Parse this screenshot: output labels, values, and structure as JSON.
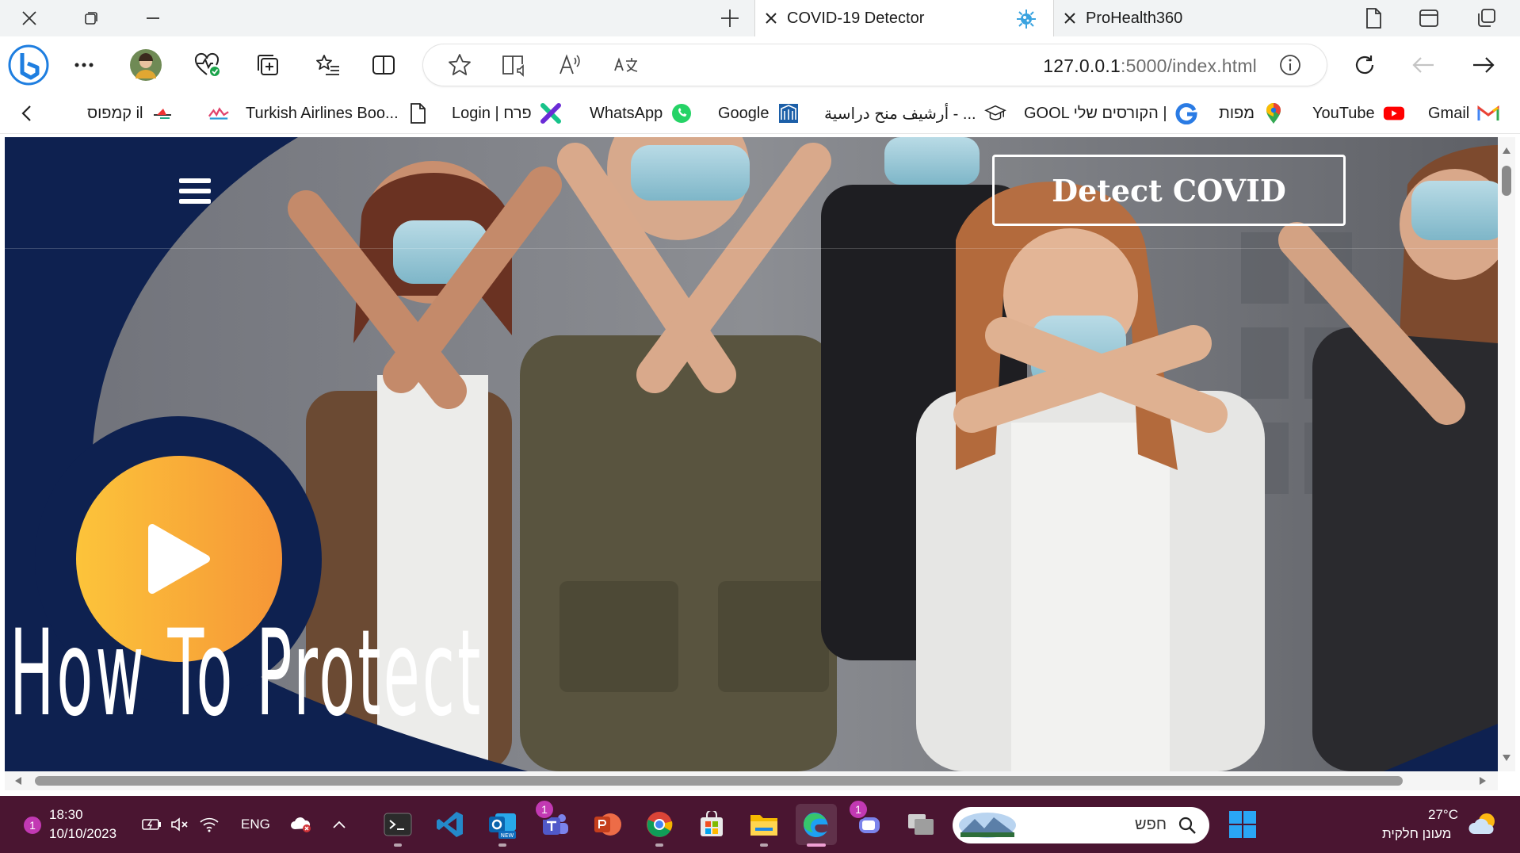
{
  "browser": {
    "tabs": [
      {
        "label": "COVID-19 Detector",
        "active": true
      },
      {
        "label": "ProHealth360",
        "active": false
      }
    ],
    "address": {
      "host": "127.0.0.1",
      "path": ":5000/index.html"
    },
    "favorites": [
      {
        "label": "Gmail",
        "icon": "gmail-icon"
      },
      {
        "label": "YouTube",
        "icon": "youtube-icon"
      },
      {
        "label": "מפות",
        "icon": "maps-pin-icon"
      },
      {
        "label": "GOOL הקורסים שלי |",
        "icon": "gool-icon"
      },
      {
        "label": "أرشيف منح دراسية - ...",
        "icon": "graduation-cap-icon"
      },
      {
        "label": "Google",
        "icon": "building-icon"
      },
      {
        "label": "WhatsApp",
        "icon": "whatsapp-icon"
      },
      {
        "label": "Login | פרח",
        "icon": "perach-icon"
      },
      {
        "label": "Turkish Airlines Boo...",
        "icon": "page-icon"
      },
      {
        "label": "",
        "icon": "colorful-logo-icon"
      },
      {
        "label": "קמפוס il",
        "icon": "campus-il-icon"
      }
    ]
  },
  "page": {
    "detect_button": "Detect COVID",
    "hero_title": "How To Protect"
  },
  "taskbar": {
    "notification_count": "1",
    "time": "18:30",
    "date": "10/10/2023",
    "language": "ENG",
    "search_placeholder": "חפש",
    "weather_temp": "27°C",
    "weather_desc": "מעונן חלקית",
    "teams_badge": "1",
    "teams2_badge": "1"
  },
  "colors": {
    "hero_navy": "#0e2150",
    "play_gradient_start": "#fcc43a",
    "play_gradient_end": "#f69637",
    "taskbar_bg": "#4a1531"
  }
}
